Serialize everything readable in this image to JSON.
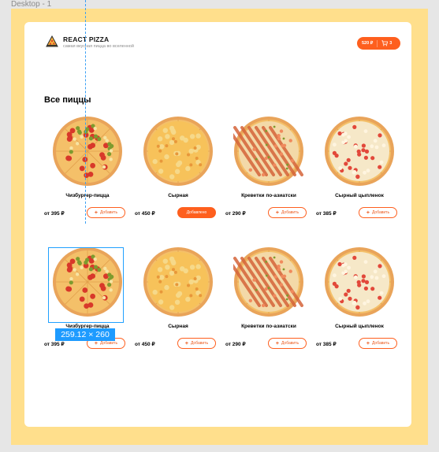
{
  "frame_label": "Desktop - 1",
  "header": {
    "brand": "REACT PIZZA",
    "tagline": "самая вкусная пицца во вселенной",
    "cart": {
      "total": "520 ₽",
      "count": "3"
    }
  },
  "section_title": "Все пиццы",
  "pizzas": [
    {
      "name": "Чизбургер-пицца",
      "price": "от 395 ₽",
      "button": "Добавить",
      "active": false
    },
    {
      "name": "Сырная",
      "price": "от 450 ₽",
      "button": "Добавлено",
      "active": true
    },
    {
      "name": "Креветки по-азиатски",
      "price": "от 290 ₽",
      "button": "Добавить",
      "active": false
    },
    {
      "name": "Сырный цыпленок",
      "price": "от 385 ₽",
      "button": "Добавить",
      "active": false
    },
    {
      "name": "Чизбургер-пицца",
      "price": "от 395 ₽",
      "button": "Добавить",
      "active": false
    },
    {
      "name": "Сырная",
      "price": "от 450 ₽",
      "button": "Добавить",
      "active": false
    },
    {
      "name": "Креветки по-азиатски",
      "price": "от 290 ₽",
      "button": "Добавить",
      "active": false
    },
    {
      "name": "Сырный цыпленок",
      "price": "от 385 ₽",
      "button": "Добавить",
      "active": false
    }
  ],
  "selection": {
    "dimensions": "259.12 × 260"
  },
  "colors": {
    "accent": "#fe5f1e",
    "frame_background": "#ffdf8c",
    "selection": "#1e9bff"
  }
}
